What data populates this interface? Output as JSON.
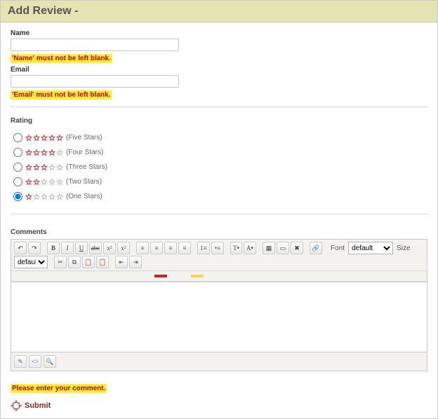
{
  "header": {
    "title": "Add Review -"
  },
  "fields": {
    "name": {
      "label": "Name",
      "value": "",
      "error": "'Name' must not be left blank."
    },
    "email": {
      "label": "Email",
      "value": "",
      "error": "'Email' must not be left blank."
    }
  },
  "rating": {
    "label": "Rating",
    "options": [
      {
        "id": "r5",
        "filled": 5,
        "text": "(Five Stars)",
        "checked": false
      },
      {
        "id": "r4",
        "filled": 4,
        "text": "(Four Stars)",
        "checked": false
      },
      {
        "id": "r3",
        "filled": 3,
        "text": "(Three Stars)",
        "checked": false
      },
      {
        "id": "r2",
        "filled": 2,
        "text": "(Two Stars)",
        "checked": false
      },
      {
        "id": "r1",
        "filled": 1,
        "text": "(One Stars)",
        "checked": true
      }
    ]
  },
  "comments": {
    "label": "Comments",
    "font_label": "Font",
    "font_value": "default",
    "size_label": "Size",
    "size_value": "default",
    "error": "Please enter your comment."
  },
  "submit": {
    "label": "Submit"
  },
  "colors": {
    "red": "#c62828",
    "yellow": "#f7d94c"
  }
}
